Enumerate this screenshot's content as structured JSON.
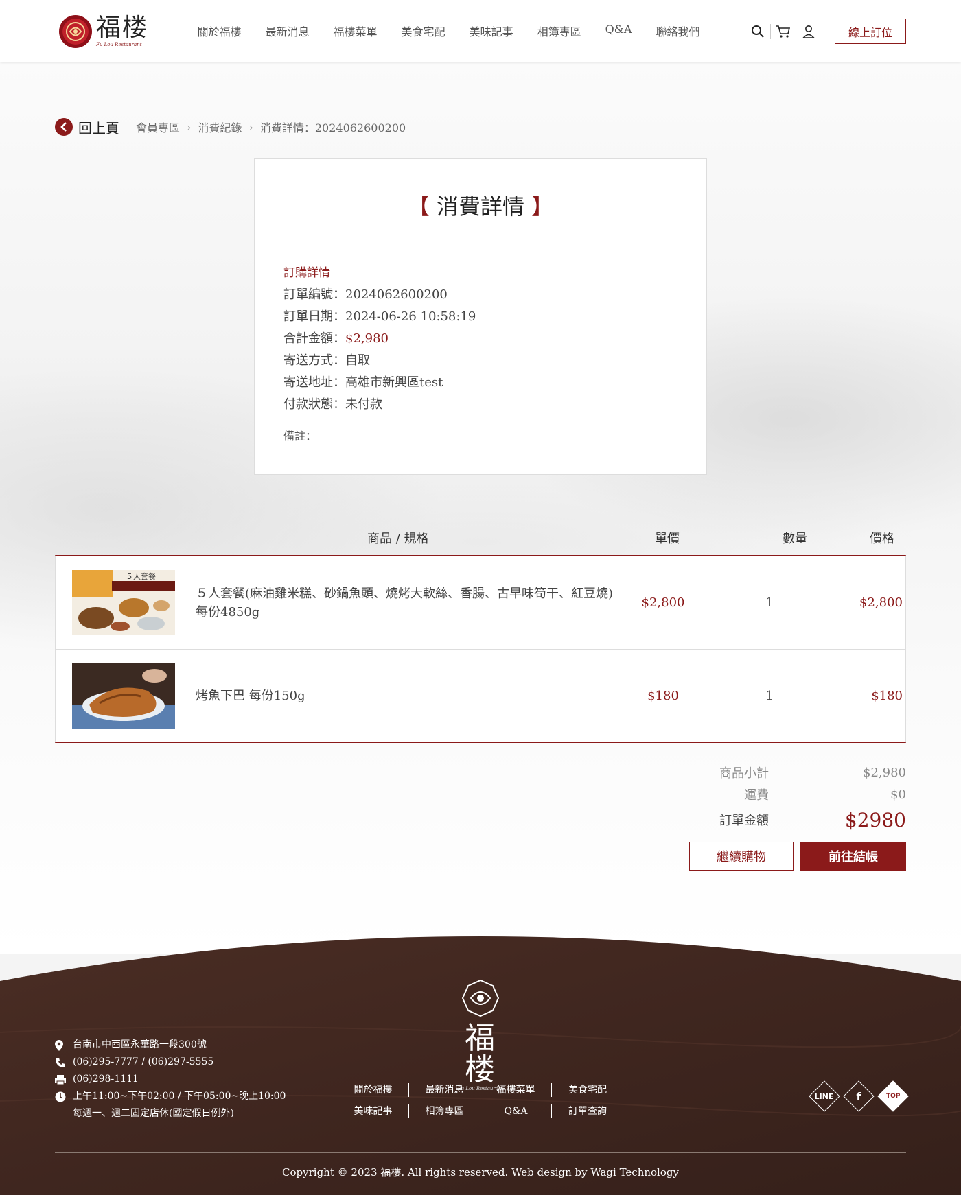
{
  "header": {
    "logo_name": "福楼",
    "logo_sub": "Fu Lou Restaurant",
    "nav": [
      "關於福樓",
      "最新消息",
      "福樓菜單",
      "美食宅配",
      "美味記事",
      "相簿專區",
      "Q&A",
      "聯絡我們"
    ],
    "reserve_label": "線上訂位",
    "icons": [
      "search-icon",
      "cart-icon",
      "user-icon"
    ]
  },
  "breadcrumb": {
    "back_label": "回上頁",
    "items": [
      "會員專區",
      "消費紀錄",
      "消費詳情：2024062600200"
    ]
  },
  "order": {
    "title": "消費詳情",
    "section_title": "訂購詳情",
    "rows": [
      {
        "label": "訂單編號：",
        "value": "2024062600200"
      },
      {
        "label": "訂單日期：",
        "value": "2024-06-26 10:58:19"
      },
      {
        "label": "合計金額：",
        "value": "$2,980"
      },
      {
        "label": "寄送方式：",
        "value": "自取"
      },
      {
        "label": "寄送地址：",
        "value": "高雄市新興區test"
      },
      {
        "label": "付款狀態：",
        "value": "未付款"
      }
    ],
    "note_label": "備註："
  },
  "table": {
    "headers": [
      "商品 / 規格",
      "單價",
      "數量",
      "價格"
    ],
    "items": [
      {
        "name": "５人套餐(麻油雞米糕、砂鍋魚頭、燒烤大軟絲、香腸、古早味筍干、紅豆燒)每份4850g",
        "price": "$2,800",
        "qty": "1",
        "total": "$2,800",
        "thumb_text": "５人套餐"
      },
      {
        "name": "烤魚下巴 每份150g",
        "price": "$180",
        "qty": "1",
        "total": "$180",
        "thumb_text": ""
      }
    ]
  },
  "summary": {
    "subtotal_label": "商品小計",
    "subtotal": "$2,980",
    "shipping_label": "運費",
    "shipping": "$0",
    "total_label": "訂單金額",
    "total": "$2980"
  },
  "buttons": {
    "continue": "繼續購物",
    "checkout": "前往結帳"
  },
  "footer": {
    "logo_name": "福楼",
    "logo_sub": "Fu Lou Restaurant",
    "address": "台南市中西區永華路一段300號",
    "phone": "(06)295-7777 / (06)297-5555",
    "fax": "(06)298-1111",
    "hours_1": "上午11:00~下午02:00 / 下午05:00~晚上10:00",
    "hours_2": "每週一、週二固定店休(國定假日例外)",
    "links_row1": [
      "關於福樓",
      "最新消息",
      "福樓菜單",
      "美食宅配"
    ],
    "links_row2": [
      "美味記事",
      "相簿專區",
      "Q&A",
      "訂單查詢"
    ],
    "social": [
      "LINE",
      "f",
      "TOP"
    ],
    "copyright": "Copyright © 2023 福樓. All rights reserved. Web design by Wagi Technology"
  },
  "colors": {
    "accent": "#8b1a1a",
    "footer_wood": "#4a2e25"
  }
}
